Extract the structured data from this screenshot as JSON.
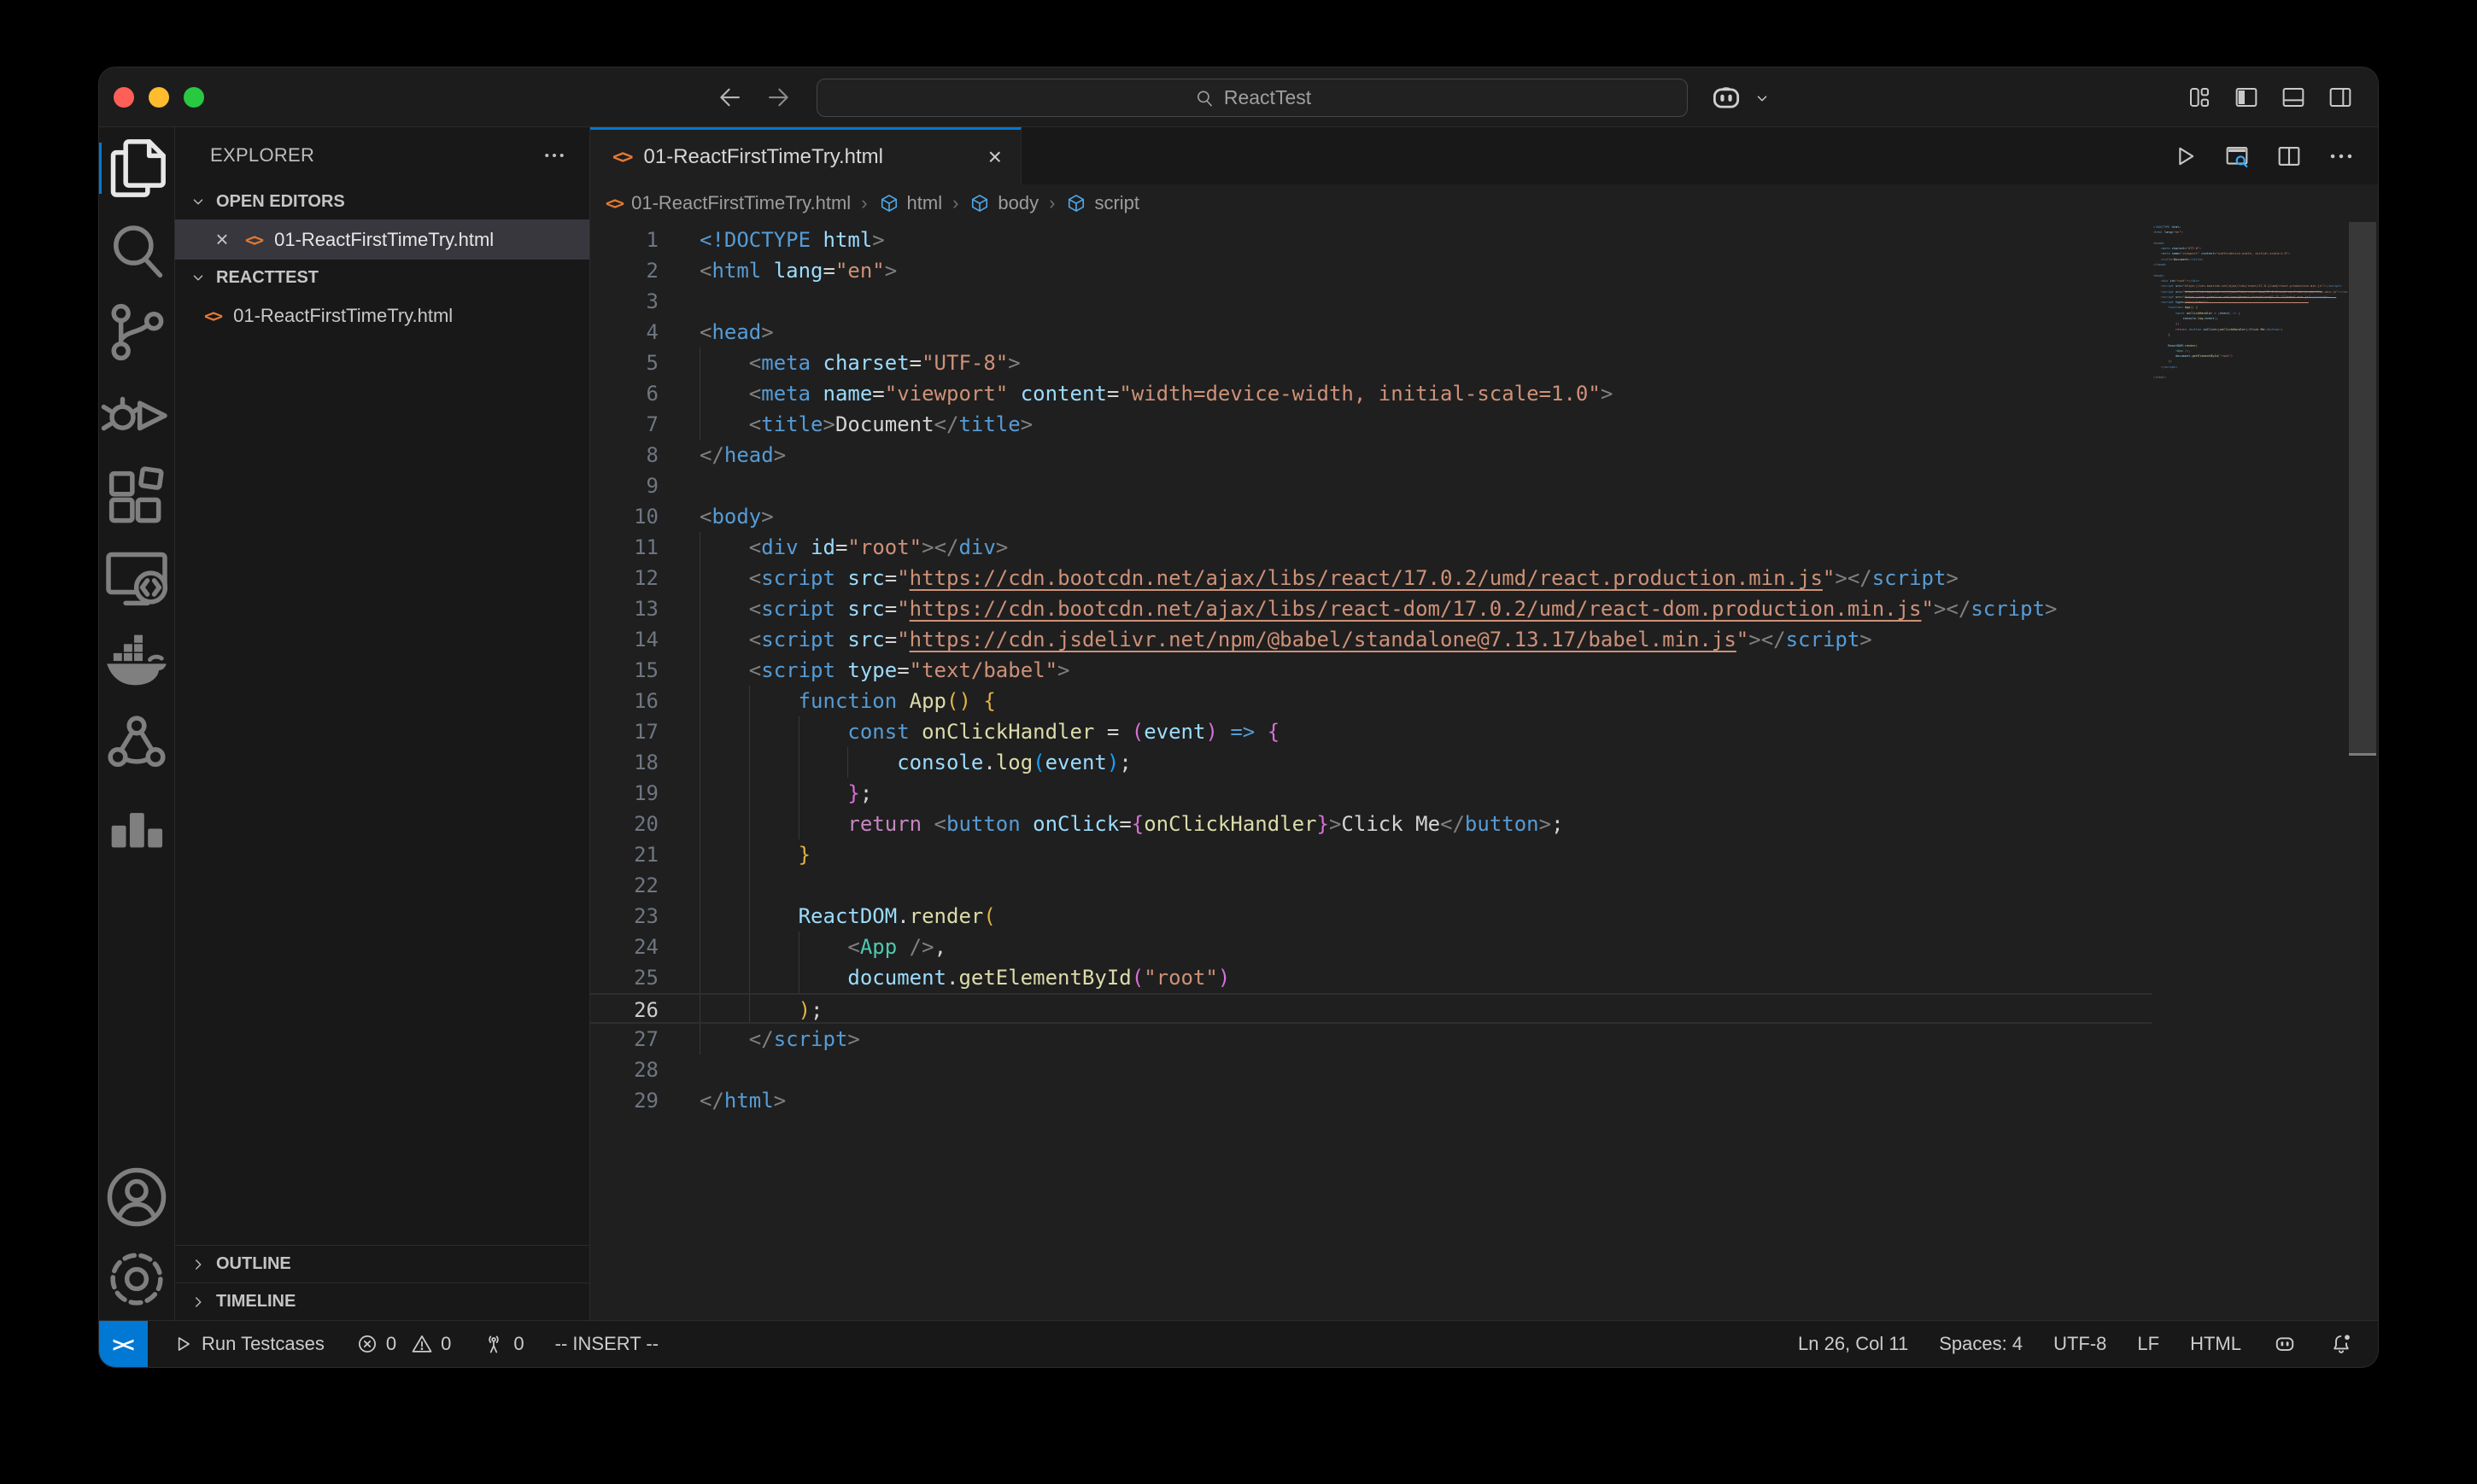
{
  "palette": {
    "accent_blue": "#0078d4",
    "editor_bg": "#1f1f1f",
    "chrome_bg": "#181818",
    "traffic": [
      "#ff5f57",
      "#febc2e",
      "#28c840"
    ],
    "syntax": {
      "tag": "#569cd6",
      "attribute": "#9cdcfe",
      "string": "#ce9178",
      "punctuation": "#808080",
      "keyword": "#569cd6",
      "control": "#c586c0",
      "function": "#dcdcaa",
      "variable": "#9cdcfe",
      "component": "#4ec9b0",
      "bracket1": "#e2b341",
      "bracket2": "#d670d6",
      "bracket3": "#179fff"
    }
  },
  "title_bar": {
    "search": {
      "value": "ReactTest",
      "icon": "search"
    },
    "nav": {
      "back_icon": "arrow-left",
      "forward_icon": "arrow-right"
    },
    "copilot_icon": "copilot",
    "layout_icons": [
      "layout-customize",
      "panel-left",
      "panel-bottom",
      "panel-right"
    ]
  },
  "activity_bar": {
    "top": [
      {
        "icon": "explorer",
        "active": true
      },
      {
        "icon": "search",
        "active": false
      },
      {
        "icon": "source-control",
        "active": false
      },
      {
        "icon": "run-debug",
        "active": false
      },
      {
        "icon": "extensions",
        "active": false
      },
      {
        "icon": "remote-explorer",
        "active": false
      },
      {
        "icon": "docker",
        "active": false
      },
      {
        "icon": "live-share",
        "active": false
      },
      {
        "icon": "chart",
        "active": false
      }
    ],
    "bottom": [
      {
        "icon": "account",
        "active": false
      },
      {
        "icon": "settings",
        "active": false
      }
    ]
  },
  "sidebar": {
    "title": "EXPLORER",
    "open_editors": {
      "label": "OPEN EDITORS",
      "file": "01-ReactFirstTimeTry.html",
      "close_glyph": "×"
    },
    "workspace": {
      "label": "REACTTEST",
      "files": [
        "01-ReactFirstTimeTry.html"
      ]
    },
    "outline_label": "OUTLINE",
    "timeline_label": "TIMELINE"
  },
  "editor": {
    "tab": {
      "label": "01-ReactFirstTimeTry.html",
      "close_glyph": "×"
    },
    "breadcrumb": [
      {
        "icon": "html-file",
        "label": "01-ReactFirstTimeTry.html"
      },
      {
        "icon": "symbol-cube",
        "label": "html"
      },
      {
        "icon": "symbol-cube",
        "label": "body"
      },
      {
        "icon": "symbol-cube",
        "label": "script"
      }
    ],
    "code": {
      "lines": [
        {
          "indent": 0,
          "tokens": [
            [
              "<!DOCTYPE ",
              "tag"
            ],
            [
              "html",
              "attr"
            ],
            [
              ">",
              "pun"
            ]
          ]
        },
        {
          "indent": 0,
          "tokens": [
            [
              "<",
              "pun"
            ],
            [
              "html",
              "tag"
            ],
            [
              " ",
              "txt"
            ],
            [
              "lang",
              "attr"
            ],
            [
              "=",
              "txt"
            ],
            [
              "\"en\"",
              "str"
            ],
            [
              ">",
              "pun"
            ]
          ]
        },
        {
          "indent": 0,
          "tokens": []
        },
        {
          "indent": 0,
          "tokens": [
            [
              "<",
              "pun"
            ],
            [
              "head",
              "tag"
            ],
            [
              ">",
              "pun"
            ]
          ]
        },
        {
          "indent": 4,
          "tokens": [
            [
              "    ",
              "txt"
            ],
            [
              "<",
              "pun"
            ],
            [
              "meta",
              "tag"
            ],
            [
              " ",
              "txt"
            ],
            [
              "charset",
              "attr"
            ],
            [
              "=",
              "txt"
            ],
            [
              "\"UTF-8\"",
              "str"
            ],
            [
              ">",
              "pun"
            ]
          ]
        },
        {
          "indent": 4,
          "tokens": [
            [
              "    ",
              "txt"
            ],
            [
              "<",
              "pun"
            ],
            [
              "meta",
              "tag"
            ],
            [
              " ",
              "txt"
            ],
            [
              "name",
              "attr"
            ],
            [
              "=",
              "txt"
            ],
            [
              "\"viewport\"",
              "str"
            ],
            [
              " ",
              "txt"
            ],
            [
              "content",
              "attr"
            ],
            [
              "=",
              "txt"
            ],
            [
              "\"width=device-width, initial-scale=1.0\"",
              "str"
            ],
            [
              ">",
              "pun"
            ]
          ]
        },
        {
          "indent": 4,
          "tokens": [
            [
              "    ",
              "txt"
            ],
            [
              "<",
              "pun"
            ],
            [
              "title",
              "tag"
            ],
            [
              ">",
              "pun"
            ],
            [
              "Document",
              "txt"
            ],
            [
              "</",
              "pun"
            ],
            [
              "title",
              "tag"
            ],
            [
              ">",
              "pun"
            ]
          ]
        },
        {
          "indent": 0,
          "tokens": [
            [
              "</",
              "pun"
            ],
            [
              "head",
              "tag"
            ],
            [
              ">",
              "pun"
            ]
          ]
        },
        {
          "indent": 0,
          "tokens": []
        },
        {
          "indent": 0,
          "tokens": [
            [
              "<",
              "pun"
            ],
            [
              "body",
              "tag"
            ],
            [
              ">",
              "pun"
            ]
          ]
        },
        {
          "indent": 4,
          "tokens": [
            [
              "    ",
              "txt"
            ],
            [
              "<",
              "pun"
            ],
            [
              "div",
              "tag"
            ],
            [
              " ",
              "txt"
            ],
            [
              "id",
              "attr"
            ],
            [
              "=",
              "txt"
            ],
            [
              "\"root\"",
              "str"
            ],
            [
              ">",
              "pun"
            ],
            [
              "</",
              "pun"
            ],
            [
              "div",
              "tag"
            ],
            [
              ">",
              "pun"
            ]
          ]
        },
        {
          "indent": 4,
          "tokens": [
            [
              "    ",
              "txt"
            ],
            [
              "<",
              "pun"
            ],
            [
              "script",
              "tag"
            ],
            [
              " ",
              "txt"
            ],
            [
              "src",
              "attr"
            ],
            [
              "=",
              "txt"
            ],
            [
              "\"",
              "str"
            ],
            [
              "https://cdn.bootcdn.net/ajax/libs/react/17.0.2/umd/react.production.min.js",
              "lnk"
            ],
            [
              "\"",
              "str"
            ],
            [
              ">",
              "pun"
            ],
            [
              "</",
              "pun"
            ],
            [
              "script",
              "tag"
            ],
            [
              ">",
              "pun"
            ]
          ]
        },
        {
          "indent": 4,
          "tokens": [
            [
              "    ",
              "txt"
            ],
            [
              "<",
              "pun"
            ],
            [
              "script",
              "tag"
            ],
            [
              " ",
              "txt"
            ],
            [
              "src",
              "attr"
            ],
            [
              "=",
              "txt"
            ],
            [
              "\"",
              "str"
            ],
            [
              "https://cdn.bootcdn.net/ajax/libs/react-dom/17.0.2/umd/react-dom.production.min.js",
              "lnk"
            ],
            [
              "\"",
              "str"
            ],
            [
              ">",
              "pun"
            ],
            [
              "</",
              "pun"
            ],
            [
              "script",
              "tag"
            ],
            [
              ">",
              "pun"
            ]
          ]
        },
        {
          "indent": 4,
          "tokens": [
            [
              "    ",
              "txt"
            ],
            [
              "<",
              "pun"
            ],
            [
              "script",
              "tag"
            ],
            [
              " ",
              "txt"
            ],
            [
              "src",
              "attr"
            ],
            [
              "=",
              "txt"
            ],
            [
              "\"",
              "str"
            ],
            [
              "https://cdn.jsdelivr.net/npm/@babel/standalone@7.13.17/babel.min.js",
              "lnk"
            ],
            [
              "\"",
              "str"
            ],
            [
              ">",
              "pun"
            ],
            [
              "</",
              "pun"
            ],
            [
              "script",
              "tag"
            ],
            [
              ">",
              "pun"
            ]
          ]
        },
        {
          "indent": 4,
          "tokens": [
            [
              "    ",
              "txt"
            ],
            [
              "<",
              "pun"
            ],
            [
              "script",
              "tag"
            ],
            [
              " ",
              "txt"
            ],
            [
              "type",
              "attr"
            ],
            [
              "=",
              "txt"
            ],
            [
              "\"text/babel\"",
              "str"
            ],
            [
              ">",
              "pun"
            ]
          ]
        },
        {
          "indent": 8,
          "tokens": [
            [
              "        ",
              "txt"
            ],
            [
              "function",
              "kw"
            ],
            [
              " ",
              "txt"
            ],
            [
              "App",
              "fn"
            ],
            [
              "(",
              "b1"
            ],
            [
              ")",
              "b1"
            ],
            [
              " ",
              "txt"
            ],
            [
              "{",
              "b1"
            ]
          ]
        },
        {
          "indent": 12,
          "tokens": [
            [
              "            ",
              "txt"
            ],
            [
              "const",
              "kw"
            ],
            [
              " ",
              "txt"
            ],
            [
              "onClickHandler",
              "fn"
            ],
            [
              " = ",
              "txt"
            ],
            [
              "(",
              "b2"
            ],
            [
              "event",
              "var"
            ],
            [
              ")",
              "b2"
            ],
            [
              " ",
              "txt"
            ],
            [
              "=>",
              "kw"
            ],
            [
              " ",
              "txt"
            ],
            [
              "{",
              "b2"
            ]
          ]
        },
        {
          "indent": 16,
          "tokens": [
            [
              "                ",
              "txt"
            ],
            [
              "console",
              "var"
            ],
            [
              ".",
              "txt"
            ],
            [
              "log",
              "fn"
            ],
            [
              "(",
              "b3"
            ],
            [
              "event",
              "var"
            ],
            [
              ")",
              "b3"
            ],
            [
              ";",
              "txt"
            ]
          ]
        },
        {
          "indent": 12,
          "tokens": [
            [
              "            ",
              "txt"
            ],
            [
              "}",
              "b2"
            ],
            [
              ";",
              "txt"
            ]
          ]
        },
        {
          "indent": 12,
          "tokens": [
            [
              "            ",
              "txt"
            ],
            [
              "return",
              "ctl"
            ],
            [
              " ",
              "txt"
            ],
            [
              "<",
              "pun"
            ],
            [
              "button",
              "tag"
            ],
            [
              " ",
              "txt"
            ],
            [
              "onClick",
              "attr"
            ],
            [
              "=",
              "txt"
            ],
            [
              "{",
              "b2"
            ],
            [
              "onClickHandler",
              "fn"
            ],
            [
              "}",
              "b2"
            ],
            [
              ">",
              "pun"
            ],
            [
              "Click Me",
              "txt"
            ],
            [
              "</",
              "pun"
            ],
            [
              "button",
              "tag"
            ],
            [
              ">",
              "pun"
            ],
            [
              ";",
              "txt"
            ]
          ]
        },
        {
          "indent": 8,
          "tokens": [
            [
              "        ",
              "txt"
            ],
            [
              "}",
              "b1"
            ]
          ]
        },
        {
          "indent": 8,
          "tokens": []
        },
        {
          "indent": 8,
          "tokens": [
            [
              "        ",
              "txt"
            ],
            [
              "ReactDOM",
              "var"
            ],
            [
              ".",
              "txt"
            ],
            [
              "render",
              "fn"
            ],
            [
              "(",
              "b1"
            ]
          ]
        },
        {
          "indent": 12,
          "tokens": [
            [
              "            ",
              "txt"
            ],
            [
              "<",
              "pun"
            ],
            [
              "App",
              "cmp"
            ],
            [
              " ",
              "txt"
            ],
            [
              "/>",
              "pun"
            ],
            [
              ",",
              "txt"
            ]
          ]
        },
        {
          "indent": 12,
          "tokens": [
            [
              "            ",
              "txt"
            ],
            [
              "document",
              "var"
            ],
            [
              ".",
              "txt"
            ],
            [
              "getElementById",
              "fn"
            ],
            [
              "(",
              "b2"
            ],
            [
              "\"root\"",
              "str"
            ],
            [
              ")",
              "b2"
            ]
          ]
        },
        {
          "indent": 8,
          "active": true,
          "tokens": [
            [
              "        ",
              "txt"
            ],
            [
              ")",
              "b1"
            ],
            [
              ";",
              "txt"
            ]
          ]
        },
        {
          "indent": 4,
          "tokens": [
            [
              "    ",
              "txt"
            ],
            [
              "</",
              "pun"
            ],
            [
              "script",
              "tag"
            ],
            [
              ">",
              "pun"
            ]
          ]
        },
        {
          "indent": 0,
          "tokens": []
        },
        {
          "indent": 0,
          "tokens": [
            [
              "</",
              "pun"
            ],
            [
              "html",
              "tag"
            ],
            [
              ">",
              "pun"
            ]
          ]
        }
      ]
    }
  },
  "status_bar": {
    "remote_glyph": "><",
    "run_label": "Run Testcases",
    "errors": "0",
    "warnings": "0",
    "ports": "0",
    "mode": "-- INSERT --",
    "cursor_position": "Ln 26, Col 11",
    "indentation": "Spaces: 4",
    "encoding": "UTF-8",
    "eol": "LF",
    "language": "HTML"
  }
}
